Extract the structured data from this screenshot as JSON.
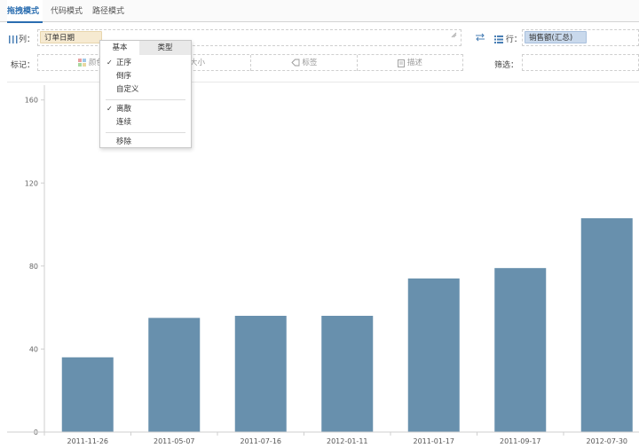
{
  "tabs": [
    {
      "label": "拖拽模式",
      "active": true
    },
    {
      "label": "代码模式",
      "active": false
    },
    {
      "label": "路径模式",
      "active": false
    }
  ],
  "columns_shelf": {
    "label": "列：",
    "field": "订单日期"
  },
  "swap_icon": "swap-icon",
  "rows_shelf": {
    "label": "行：",
    "field": "销售额(汇总)"
  },
  "marks_shelf": {
    "label": "标记：",
    "items": [
      {
        "label": "颜色",
        "icon": "palette-icon"
      },
      {
        "label": "大小",
        "icon": "size-icon"
      },
      {
        "label": "标签",
        "icon": "tag-icon"
      },
      {
        "label": "描述",
        "icon": "clipboard-icon"
      }
    ]
  },
  "filter_shelf": {
    "label": "筛选："
  },
  "menu": {
    "tabs": [
      "基本",
      "类型"
    ],
    "sort_items": [
      {
        "label": "正序",
        "checked": true
      },
      {
        "label": "倒序",
        "checked": false
      },
      {
        "label": "自定义",
        "checked": false
      }
    ],
    "scale_items": [
      {
        "label": "离散",
        "checked": true
      },
      {
        "label": "连续",
        "checked": false
      }
    ],
    "remove_label": "移除"
  },
  "check_mark": "✓",
  "colors": {
    "bar": "#6890ad",
    "accent": "#2a6db0"
  },
  "chart_data": {
    "type": "bar",
    "categories": [
      "2011-11-26",
      "2011-05-07",
      "2011-07-16",
      "2012-01-11",
      "2011-01-17",
      "2011-09-17",
      "2012-07-30"
    ],
    "values": [
      36,
      55,
      56,
      56,
      74,
      79,
      103
    ],
    "ylim": [
      0,
      162
    ],
    "yticks": [
      0,
      40,
      80,
      120,
      160
    ],
    "ytick_labels": [
      "0",
      "40",
      "80",
      "120",
      "160"
    ],
    "xlabel": "",
    "ylabel": "",
    "grid": false
  }
}
